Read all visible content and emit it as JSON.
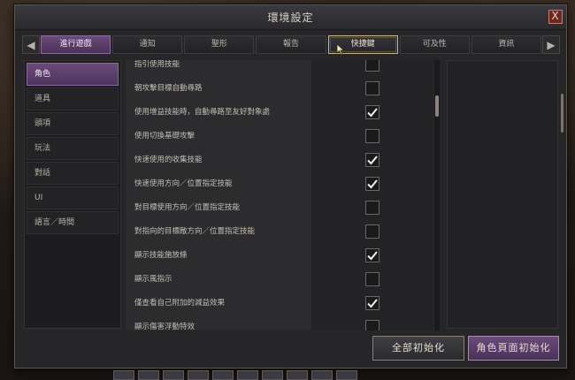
{
  "window": {
    "title": "環境設定",
    "close_label": "X"
  },
  "tabs": {
    "prev_arrow": "◀",
    "next_arrow": "▶",
    "items": [
      {
        "label": "進行遊戲",
        "state": "active"
      },
      {
        "label": "通知",
        "state": ""
      },
      {
        "label": "聖形",
        "state": ""
      },
      {
        "label": "報告",
        "state": ""
      },
      {
        "label": "快捷鍵",
        "state": "hover"
      },
      {
        "label": "可及性",
        "state": ""
      },
      {
        "label": "資訊",
        "state": ""
      }
    ]
  },
  "sidebar": {
    "items": [
      {
        "label": "角色",
        "active": true
      },
      {
        "label": "道具",
        "active": false
      },
      {
        "label": "頭項",
        "active": false
      },
      {
        "label": "玩法",
        "active": false
      },
      {
        "label": "對話",
        "active": false
      },
      {
        "label": "UI",
        "active": false
      },
      {
        "label": "語言／時間",
        "active": false
      }
    ]
  },
  "options": [
    {
      "label": "指引使用技能",
      "checked": false
    },
    {
      "label": "朝攻擊目標自動尋路",
      "checked": false
    },
    {
      "label": "使用增益技能時，自動尋路至友好對象處",
      "checked": true
    },
    {
      "label": "使用切換基礎攻擊",
      "checked": false
    },
    {
      "label": "快速使用的收集技能",
      "checked": true
    },
    {
      "label": "快速使用方向／位置指定技能",
      "checked": true
    },
    {
      "label": "對目標使用方向／位置指定技能",
      "checked": false
    },
    {
      "label": "對指向的目標敵方向／位置指定技能",
      "checked": false
    },
    {
      "label": "顯示技能施放條",
      "checked": true
    },
    {
      "label": "顯示風指示",
      "checked": false
    },
    {
      "label": "僅查看自己附加的減益效果",
      "checked": true
    },
    {
      "label": "顯示傷害浮動特效",
      "checked": false
    }
  ],
  "buttons": {
    "reset_all": "全部初始化",
    "reset_character": "角色頁面初始化"
  },
  "colors": {
    "accent_purple": "#6a4a7a",
    "panel_bg": "#262628",
    "check_white": "#f0f0f0"
  }
}
